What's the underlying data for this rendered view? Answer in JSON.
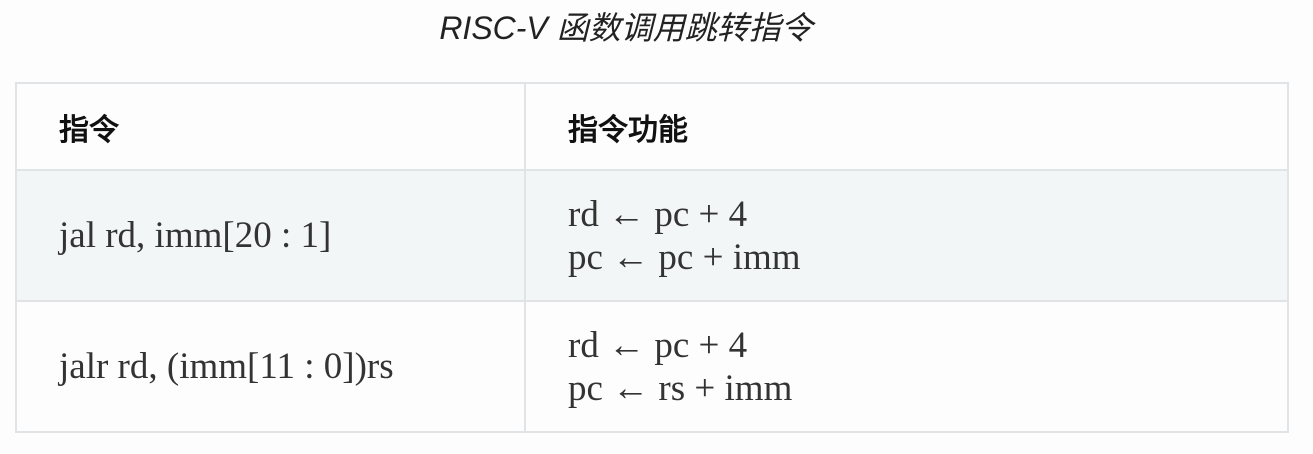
{
  "caption": "RISC-V 函数调用跳转指令",
  "table": {
    "headers": [
      "指令",
      "指令功能"
    ],
    "rows": [
      {
        "instruction": "jal rd,  imm[20 : 1]",
        "function": [
          "rd ← pc + 4",
          "pc ← pc + imm"
        ]
      },
      {
        "instruction": "jalr rd,  (imm[11 : 0])rs",
        "function": [
          "rd ← pc + 4",
          "pc ← rs + imm"
        ]
      }
    ]
  }
}
